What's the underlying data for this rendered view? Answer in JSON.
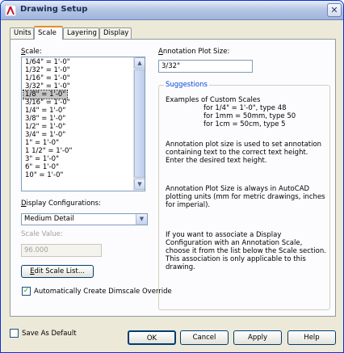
{
  "window": {
    "title": "Drawing Setup",
    "close_glyph": "✕"
  },
  "tabs": [
    {
      "label": "Units",
      "active": false
    },
    {
      "label": "Scale",
      "active": true
    },
    {
      "label": "Layering",
      "active": false
    },
    {
      "label": "Display",
      "active": false
    }
  ],
  "scale": {
    "label": "Scale:",
    "items": [
      "1/64\" = 1'-0\"",
      "1/32\" = 1'-0\"",
      "1/16\" = 1'-0\"",
      "3/32\" = 1'-0\"",
      "1/8\" = 1'-0\"",
      "3/16\" = 1'-0\"",
      "1/4\" = 1'-0\"",
      "3/8\" = 1'-0\"",
      "1/2\" = 1'-0\"",
      "3/4\" = 1'-0\"",
      "1\" = 1'-0\"",
      "1 1/2\" = 1'-0\"",
      "3\" = 1'-0\"",
      "6\" = 1'-0\"",
      "10\" = 1'-0\""
    ],
    "selected_index": 4
  },
  "display_config": {
    "label": "Display Configurations:",
    "value": "Medium Detail"
  },
  "scale_value": {
    "label": "Scale Value:",
    "value": "96.000"
  },
  "edit_scale_list_button": "Edit Scale List...",
  "dimscale_checkbox": {
    "label": "Automatically Create Dimscale Override",
    "checked": true
  },
  "annotation": {
    "label": "Annotation Plot Size:",
    "value": "3/32\""
  },
  "suggestions": {
    "title": "Suggestions",
    "examples_title": "Examples of Custom Scales",
    "examples": [
      "for 1/4\" = 1'-0\", type 48",
      "for 1mm = 50mm, type 50",
      "for 1cm = 50cm, type 5"
    ],
    "para1": "Annotation plot size is used to set annotation containing text to the correct text height. Enter the desired text height.",
    "para2": "Annotation Plot Size is always in AutoCAD plotting units (mm for metric drawings, inches for imperial).",
    "para3": "If you want to associate a Display Configuration with an Annotation Scale, choose it from the list below the Scale section. This association is only applicable to this drawing."
  },
  "footer": {
    "save_default": {
      "label": "Save As Default",
      "checked": false
    },
    "ok": "OK",
    "cancel": "Cancel",
    "apply": "Apply",
    "help": "Help"
  }
}
